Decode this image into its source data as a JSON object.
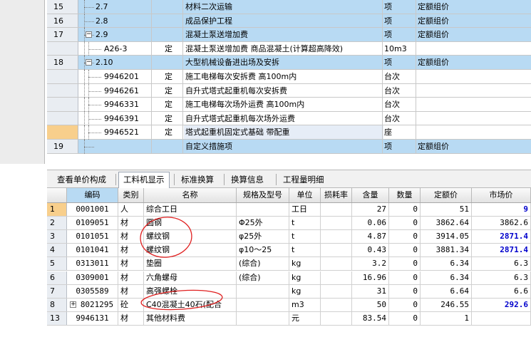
{
  "upper_rows": [
    {
      "num": "15",
      "code": "2.7",
      "type": "",
      "name": "材料二次运输",
      "unit": "项",
      "price": "定额组价",
      "style": "blue",
      "level": 1,
      "toggle": ""
    },
    {
      "num": "16",
      "code": "2.8",
      "type": "",
      "name": "成品保护工程",
      "unit": "项",
      "price": "定额组价",
      "style": "blue",
      "level": 1,
      "toggle": ""
    },
    {
      "num": "17",
      "code": "2.9",
      "type": "",
      "name": "混凝土泵送增加费",
      "unit": "项",
      "price": "定额组价",
      "style": "blue",
      "level": 1,
      "toggle": "−"
    },
    {
      "num": "",
      "code": "A26-3",
      "type": "定",
      "name": "混凝土泵送增加费 商品混凝土(计算超高降效)",
      "unit": "10m3",
      "price": "",
      "style": "white",
      "level": 2,
      "toggle": ""
    },
    {
      "num": "18",
      "code": "2.10",
      "type": "",
      "name": "大型机械设备进出场及安拆",
      "unit": "项",
      "price": "定额组价",
      "style": "blue",
      "level": 1,
      "toggle": "−"
    },
    {
      "num": "",
      "code": "9946201",
      "type": "定",
      "name": "施工电梯每次安拆费 高100m内",
      "unit": "台次",
      "price": "",
      "style": "white",
      "level": 2,
      "toggle": ""
    },
    {
      "num": "",
      "code": "9946261",
      "type": "定",
      "name": "自升式塔式起重机每次安拆费",
      "unit": "台次",
      "price": "",
      "style": "white",
      "level": 2,
      "toggle": ""
    },
    {
      "num": "",
      "code": "9946331",
      "type": "定",
      "name": "施工电梯每次场外运费 高100m内",
      "unit": "台次",
      "price": "",
      "style": "white",
      "level": 2,
      "toggle": ""
    },
    {
      "num": "",
      "code": "9946391",
      "type": "定",
      "name": "自升式塔式起重机每次场外运费",
      "unit": "台次",
      "price": "",
      "style": "white",
      "level": 2,
      "toggle": ""
    },
    {
      "num": "",
      "code": "9946521",
      "type": "定",
      "name": "塔式起重机固定式基础 带配重",
      "unit": "座",
      "price": "",
      "style": "white",
      "level": 2,
      "toggle": "",
      "selected": true
    },
    {
      "num": "19",
      "code": "",
      "type": "",
      "name": "自定义措施项",
      "unit": "项",
      "price": "定额组价",
      "style": "blue",
      "level": 1,
      "toggle": ""
    }
  ],
  "tabs": [
    {
      "label": "查看单价构成",
      "active": false
    },
    {
      "label": "工料机显示",
      "active": true
    },
    {
      "label": "标准换算",
      "active": false
    },
    {
      "label": "换算信息",
      "active": false
    },
    {
      "label": "工程量明细",
      "active": false
    }
  ],
  "lower_headers": [
    "",
    "编码",
    "类别",
    "名称",
    "规格及型号",
    "单位",
    "损耗率",
    "含量",
    "数量",
    "定额价",
    "市场价"
  ],
  "lower_rows": [
    {
      "rn": "1",
      "code": "0001001",
      "cat": "人",
      "name": "综合工日",
      "spec": "",
      "unit": "工日",
      "loss": "",
      "qty": "27",
      "amount": "0",
      "price": "51",
      "market": "9",
      "mblue": true,
      "expand": false
    },
    {
      "rn": "2",
      "code": "0109051",
      "cat": "材",
      "name": "圆钢",
      "spec": "Φ25外",
      "unit": "t",
      "loss": "",
      "qty": "0.06",
      "amount": "0",
      "price": "3862.64",
      "market": "3862.6",
      "mblue": false,
      "expand": false
    },
    {
      "rn": "3",
      "code": "0101051",
      "cat": "材",
      "name": "螺纹钢",
      "spec": "φ25外",
      "unit": "t",
      "loss": "",
      "qty": "4.87",
      "amount": "0",
      "price": "3914.05",
      "market": "2871.4",
      "mblue": true,
      "expand": false
    },
    {
      "rn": "4",
      "code": "0101041",
      "cat": "材",
      "name": "螺纹钢",
      "spec": "φ10～25",
      "unit": "t",
      "loss": "",
      "qty": "0.43",
      "amount": "0",
      "price": "3881.34",
      "market": "2871.4",
      "mblue": true,
      "expand": false
    },
    {
      "rn": "5",
      "code": "0313011",
      "cat": "材",
      "name": "垫圈",
      "spec": "(综合)",
      "unit": "kg",
      "loss": "",
      "qty": "3.2",
      "amount": "0",
      "price": "6.34",
      "market": "6.3",
      "mblue": false,
      "expand": false
    },
    {
      "rn": "6",
      "code": "0309001",
      "cat": "材",
      "name": "六角螺母",
      "spec": "(综合)",
      "unit": "kg",
      "loss": "",
      "qty": "16.96",
      "amount": "0",
      "price": "6.34",
      "market": "6.3",
      "mblue": false,
      "expand": false
    },
    {
      "rn": "7",
      "code": "0305589",
      "cat": "材",
      "name": "高强螺栓",
      "spec": "",
      "unit": "kg",
      "loss": "",
      "qty": "31",
      "amount": "0",
      "price": "6.64",
      "market": "6.6",
      "mblue": false,
      "expand": false
    },
    {
      "rn": "8",
      "code": "8021295",
      "cat": "砼",
      "name": "C40混凝土40石(配合",
      "spec": "",
      "unit": "m3",
      "loss": "",
      "qty": "50",
      "amount": "0",
      "price": "246.55",
      "market": "292.6",
      "mblue": true,
      "expand": true
    },
    {
      "rn": "13",
      "code": "9946131",
      "cat": "材",
      "name": "其他材料费",
      "spec": "",
      "unit": "元",
      "loss": "",
      "qty": "83.54",
      "amount": "0",
      "price": "1",
      "market": "",
      "mblue": false,
      "expand": false
    }
  ]
}
